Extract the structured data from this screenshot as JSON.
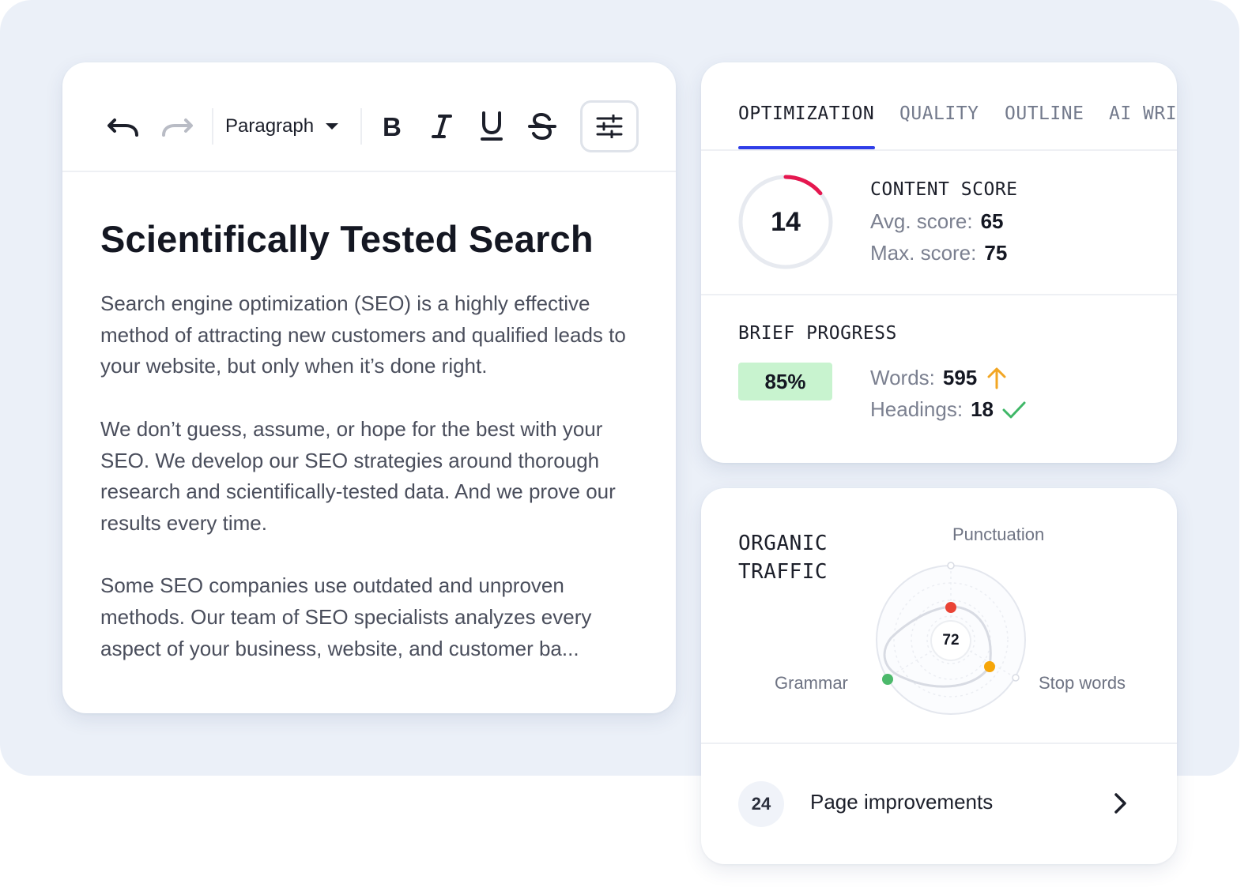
{
  "editor": {
    "toolbar": {
      "block_type": "Paragraph",
      "icons": [
        "undo-icon",
        "redo-icon",
        "bold-icon",
        "italic-icon",
        "underline-icon",
        "strikethrough-icon",
        "sliders-icon"
      ]
    },
    "title": "Scientifically Tested Search",
    "paragraphs": [
      "Search engine optimization (SEO) is a highly effective method of attracting new customers and qualified leads to your website, but only when it’s done right.",
      "We don’t guess, assume, or hope for the best with your SEO. We develop our SEO strategies around thorough research and scientifically-tested data. And we prove our results every time.",
      "Some SEO companies use outdated and unproven methods. Our team of SEO specialists analyzes every aspect of your business, website, and customer ba..."
    ]
  },
  "optimization": {
    "tabs": [
      "OPTIMIZATION",
      "QUALITY",
      "OUTLINE",
      "AI WRI"
    ],
    "active_tab": "OPTIMIZATION",
    "content_score": {
      "label": "CONTENT SCORE",
      "value": "14",
      "value_fraction": 0.14,
      "avg_label": "Avg. score:",
      "avg_value": "65",
      "max_label": "Max. score:",
      "max_value": "75"
    },
    "brief_progress": {
      "label": "BRIEF PROGRESS",
      "percent": "85%",
      "words_label": "Words:",
      "words_value": "595",
      "headings_label": "Headings:",
      "headings_value": "18"
    }
  },
  "organic_traffic": {
    "title_line1": "ORGANIC",
    "title_line2": "TRAFFIC",
    "center_score": "72",
    "axes": [
      "Punctuation",
      "Stop words",
      "Grammar"
    ],
    "colors": {
      "punctuation": "#ea4335",
      "stop_words": "#f6a609",
      "grammar": "#4cb96b"
    },
    "improvements_count": "24",
    "improvements_label": "Page improvements"
  },
  "colors": {
    "accent": "#2f3ee8",
    "score_arc": "#e5174f",
    "progress_bg": "#c8f3cf",
    "arrow_up": "#f2a623",
    "check": "#3fb767"
  }
}
